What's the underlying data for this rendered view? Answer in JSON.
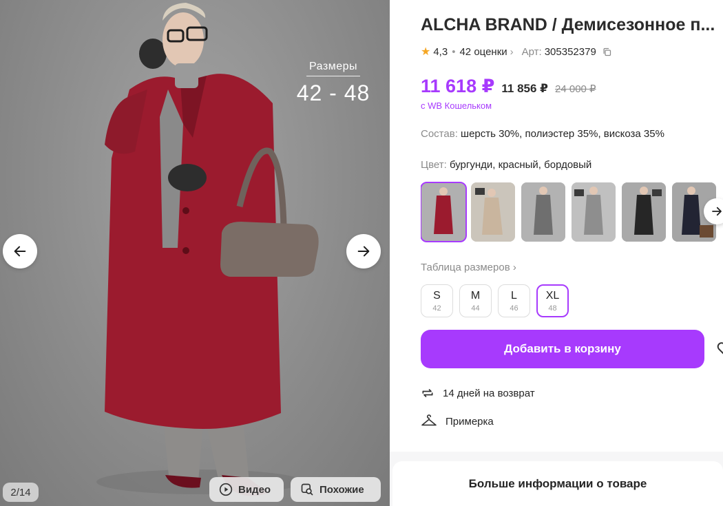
{
  "gallery": {
    "size_overlay_label": "Размеры",
    "size_overlay_value": "42 - 48",
    "counter": "2/14",
    "video_label": "Видео",
    "similar_label": "Похожие"
  },
  "product": {
    "title": "ALCHA BRAND / Демисезонное п...",
    "rating": "4,3",
    "reviews": "42 оценки",
    "art_label": "Арт:",
    "art_number": "305352379",
    "price_main": "11 618 ₽",
    "price_mid": "11 856 ₽",
    "price_old": "24 000 ₽",
    "wallet_note": "с WB Кошельком",
    "composition_label": "Состав:",
    "composition_value": "шерсть 30%, полиэстер 35%, вискоза 35%",
    "color_label": "Цвет:",
    "color_value": "бургунди, красный, бордовый",
    "size_table_label": "Таблица размеров",
    "sizes": [
      {
        "size": "S",
        "ru": "42"
      },
      {
        "size": "M",
        "ru": "44"
      },
      {
        "size": "L",
        "ru": "46"
      },
      {
        "size": "XL",
        "ru": "48"
      }
    ],
    "selected_size": "XL",
    "cart_label": "Добавить в корзину",
    "return_text": "14 дней на возврат",
    "fitting_text": "Примерка",
    "more_info": "Больше информации о товаре"
  },
  "swatches": [
    {
      "color": "burgundy",
      "selected": true
    },
    {
      "color": "beige",
      "selected": false
    },
    {
      "color": "grey",
      "selected": false
    },
    {
      "color": "light-grey",
      "selected": false
    },
    {
      "color": "black",
      "selected": false
    },
    {
      "color": "navy",
      "selected": false
    }
  ],
  "colors": {
    "accent": "#a73afd",
    "star": "#f5a623",
    "coat": "#9b1b2e",
    "background": "#8c8c8c"
  }
}
